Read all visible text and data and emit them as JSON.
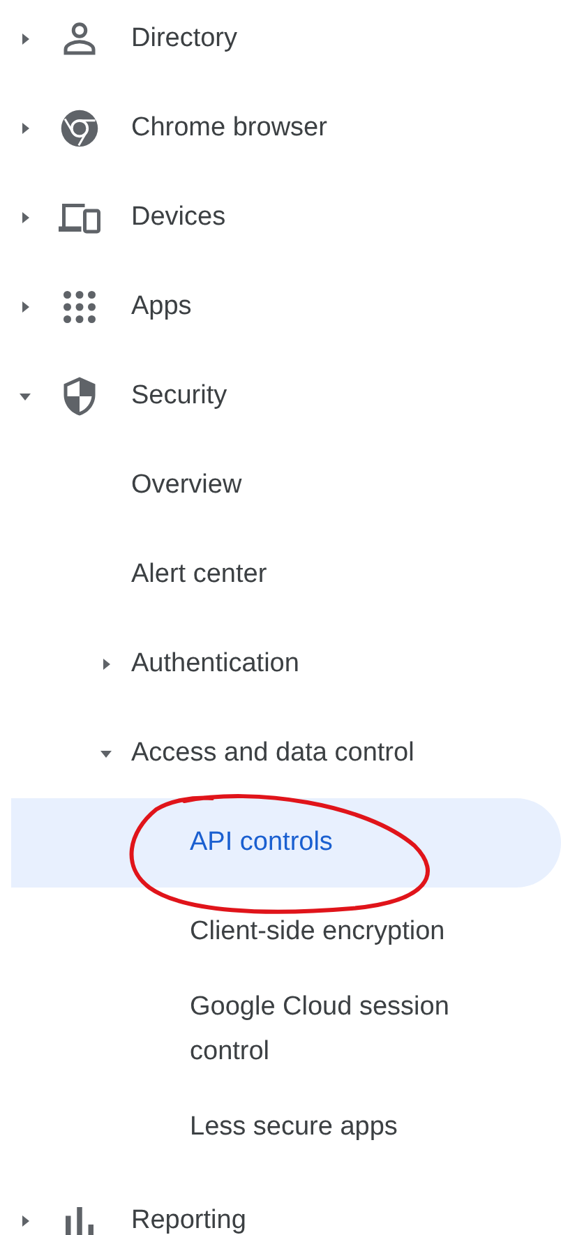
{
  "nav": [
    {
      "label": "Directory",
      "kind": "person",
      "expanded": false,
      "selected": false
    },
    {
      "label": "Chrome browser",
      "kind": "browser",
      "expanded": false,
      "selected": false
    },
    {
      "label": "Devices",
      "kind": "devices",
      "expanded": false,
      "selected": false
    },
    {
      "label": "Apps",
      "kind": "grid",
      "expanded": false,
      "selected": false
    },
    {
      "label": "Security",
      "kind": "shield",
      "expanded": true,
      "selected": false,
      "children": [
        {
          "label": "Overview",
          "selected": false
        },
        {
          "label": "Alert center",
          "selected": false
        },
        {
          "label": "Authentication",
          "expanded": false,
          "selected": false
        },
        {
          "label": "Access and data control",
          "expanded": true,
          "selected": false,
          "children": [
            {
              "label": "API controls",
              "selected": true,
              "circled": true
            },
            {
              "label": "Client-side encryption",
              "selected": false,
              "circled": false
            },
            {
              "label": "Google Cloud session control",
              "selected": false,
              "circled": false
            },
            {
              "label": "Less secure apps",
              "selected": false,
              "circled": false
            }
          ]
        }
      ]
    },
    {
      "label": "Reporting",
      "kind": "chart",
      "expanded": false,
      "selected": false
    }
  ]
}
